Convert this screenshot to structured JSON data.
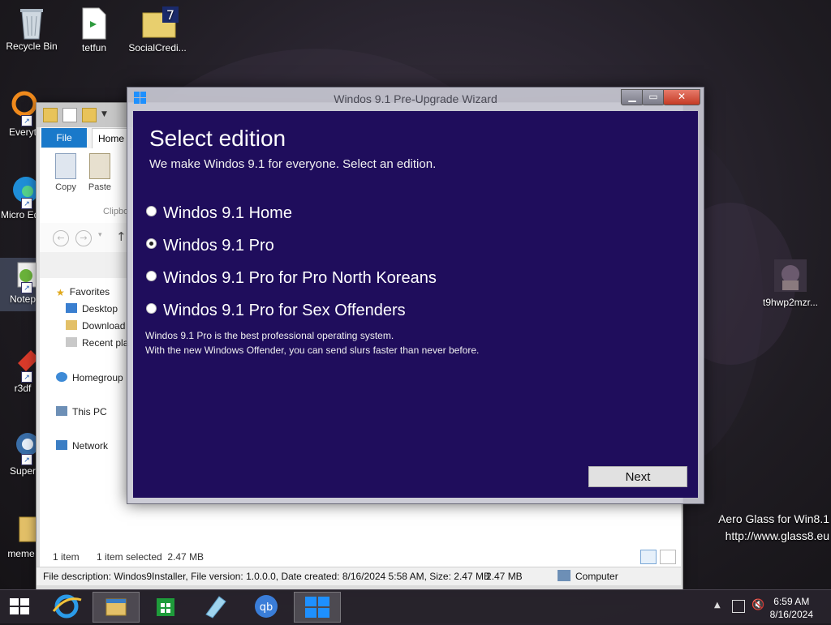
{
  "desktop": {
    "icons": [
      {
        "label": "Recycle Bin"
      },
      {
        "label": "tetfun"
      },
      {
        "label": "SocialCredi..."
      },
      {
        "label": "Everyt"
      },
      {
        "label": "Micro Edg"
      },
      {
        "label": "Notep"
      },
      {
        "label": "r3df"
      },
      {
        "label": "Super"
      },
      {
        "label": "meme sh"
      },
      {
        "label": "t9hwp2mzr..."
      }
    ],
    "watermark_line1": "Aero Glass for Win8.1",
    "watermark_line2": "http://www.glass8.eu"
  },
  "explorer": {
    "tabs": {
      "file": "File",
      "home": "Home"
    },
    "ribbon": {
      "copy": "Copy",
      "paste": "Paste",
      "group": "Clipbo"
    },
    "nav": [
      {
        "label": "Favorites"
      },
      {
        "label": "Desktop"
      },
      {
        "label": "Download"
      },
      {
        "label": "Recent pla"
      },
      {
        "label": "Homegroup"
      },
      {
        "label": "This PC"
      },
      {
        "label": "Network"
      }
    ],
    "status": {
      "items": "1 item",
      "selected": "1 item selected  2.47 MB"
    },
    "details": {
      "description": "File description: Windos9Installer, File version: 1.0.0.0, Date created: 8/16/2024 5:58 AM, Size: 2.47 MB",
      "size": "2.47 MB",
      "location": "Computer"
    }
  },
  "wizard": {
    "title": "Windos 9.1 Pre-Upgrade Wizard",
    "heading": "Select edition",
    "subheading": "We make Windos 9.1 for everyone. Select an edition.",
    "options": [
      {
        "label": "Windos 9.1 Home",
        "checked": false
      },
      {
        "label": "Windos 9.1 Pro",
        "checked": true
      },
      {
        "label": "Windos 9.1 Pro for Pro North Koreans",
        "checked": false
      },
      {
        "label": "Windos 9.1 Pro for Sex Offenders",
        "checked": false
      }
    ],
    "description_line1": "Windos 9.1 Pro is the best professional operating system.",
    "description_line2": "With the new Windows Offender, you can send slurs faster than never before.",
    "next_label": "Next",
    "accent": "#1f0d5c"
  },
  "taskbar": {
    "time": "6:59 AM",
    "date": "8/16/2024"
  }
}
